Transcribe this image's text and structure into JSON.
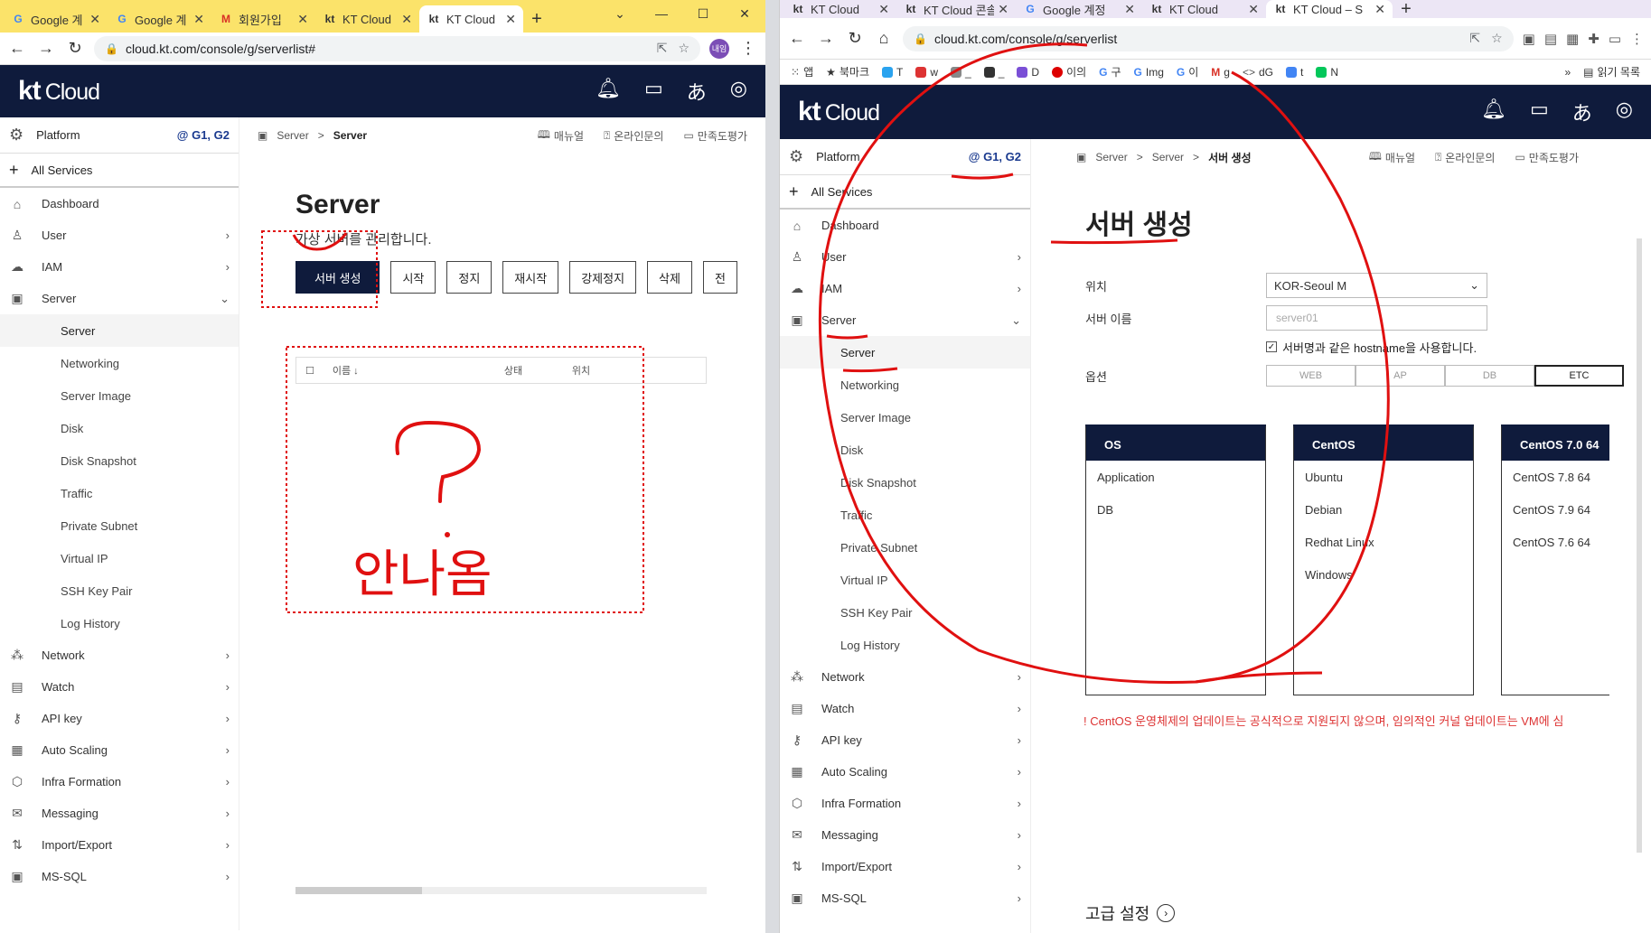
{
  "left": {
    "tabs": [
      {
        "icon": "G",
        "title": "Google 계"
      },
      {
        "icon": "G",
        "title": "Google 계"
      },
      {
        "icon": "M",
        "title": "회원가입"
      },
      {
        "icon": "kt",
        "title": "KT Cloud"
      },
      {
        "icon": "kt",
        "title": "KT Cloud"
      }
    ],
    "url": "cloud.kt.com/console/g/serverlist#",
    "profile": "내임",
    "brand": {
      "kt": "kt",
      "cloud": "Cloud"
    },
    "sidebar": {
      "platform": "Platform",
      "zone": "@ G1, G2",
      "all_services": "All Services",
      "items": [
        {
          "label": "Dashboard"
        },
        {
          "label": "User"
        },
        {
          "label": "IAM"
        },
        {
          "label": "Server"
        }
      ],
      "sub_items": [
        "Server",
        "Networking",
        "Server Image",
        "Disk",
        "Disk Snapshot",
        "Traffic",
        "Private Subnet",
        "Virtual IP",
        "SSH Key Pair",
        "Log History"
      ],
      "bottom_items": [
        "Network",
        "Watch",
        "API key",
        "Auto Scaling",
        "Infra Formation",
        "Messaging",
        "Import/Export",
        "MS-SQL"
      ]
    },
    "crumb": {
      "parent": "Server",
      "sep": ">",
      "current": "Server",
      "manual": "매뉴얼",
      "inquiry": "온라인문의",
      "survey": "만족도평가"
    },
    "page": {
      "title": "Server",
      "desc": "가상 서버를 관리합니다.",
      "buttons": [
        "서버 생성",
        "시작",
        "정지",
        "재시작",
        "강제정지",
        "삭제",
        "전"
      ],
      "table_cols": [
        "이름 ↓",
        "상태",
        "위치"
      ]
    }
  },
  "right": {
    "tabs": [
      {
        "icon": "kt",
        "title": "KT Cloud"
      },
      {
        "icon": "kt",
        "title": "KT Cloud 콘솔"
      },
      {
        "icon": "G",
        "title": "Google 계정"
      },
      {
        "icon": "kt",
        "title": "KT Cloud"
      },
      {
        "icon": "kt",
        "title": "KT Cloud – S"
      }
    ],
    "url": "cloud.kt.com/console/g/serverlist",
    "bookmarks": [
      "앱",
      "북마크",
      "T",
      "w",
      "_",
      "_",
      "D",
      "이의",
      "구",
      "Img",
      "이",
      "g",
      "dG",
      "t",
      "N"
    ],
    "reading_list": "읽기 목록",
    "brand": {
      "kt": "kt",
      "cloud": "Cloud"
    },
    "sidebar": {
      "platform": "Platform",
      "zone": "@ G1, G2",
      "all_services": "All Services",
      "items": [
        {
          "label": "Dashboard"
        },
        {
          "label": "User"
        },
        {
          "label": "IAM"
        },
        {
          "label": "Server"
        }
      ],
      "sub_items": [
        "Server",
        "Networking",
        "Server Image",
        "Disk",
        "Disk Snapshot",
        "Traffic",
        "Private Subnet",
        "Virtual IP",
        "SSH Key Pair",
        "Log History"
      ],
      "bottom_items": [
        "Network",
        "Watch",
        "API key",
        "Auto Scaling",
        "Infra Formation",
        "Messaging",
        "Import/Export",
        "MS-SQL"
      ]
    },
    "crumb": {
      "a": "Server",
      "b": "Server",
      "current": "서버 생성",
      "sep": ">",
      "manual": "매뉴얼",
      "inquiry": "온라인문의",
      "survey": "만족도평가"
    },
    "form": {
      "title": "서버 생성",
      "location_label": "위치",
      "location_value": "KOR-Seoul M",
      "name_label": "서버 이름",
      "name_placeholder": "server01",
      "hostname_check": "서버명과 같은 hostname을 사용합니다.",
      "option_label": "옵션",
      "options": [
        "WEB",
        "AP",
        "DB",
        "ETC"
      ],
      "os_col": {
        "header": "OS",
        "items": [
          "Application",
          "DB"
        ]
      },
      "dist_col": {
        "header": "CentOS",
        "items": [
          "Ubuntu",
          "Debian",
          "Redhat Linux",
          "Windows"
        ]
      },
      "ver_col": {
        "header": "CentOS 7.0 64",
        "items": [
          "CentOS 7.8 64",
          "CentOS 7.9 64",
          "CentOS 7.6 64"
        ]
      },
      "warning": "! CentOS 운영체제의 업데이트는 공식적으로 지원되지 않으며, 임의적인 커널 업데이트는 VM에 심",
      "advanced": "고급 설정"
    }
  },
  "annotation_text": "안나옴",
  "colors": {
    "navy": "#0f1b3c",
    "annotation_red": "#e01010",
    "zone_blue": "#1a3a8f"
  }
}
